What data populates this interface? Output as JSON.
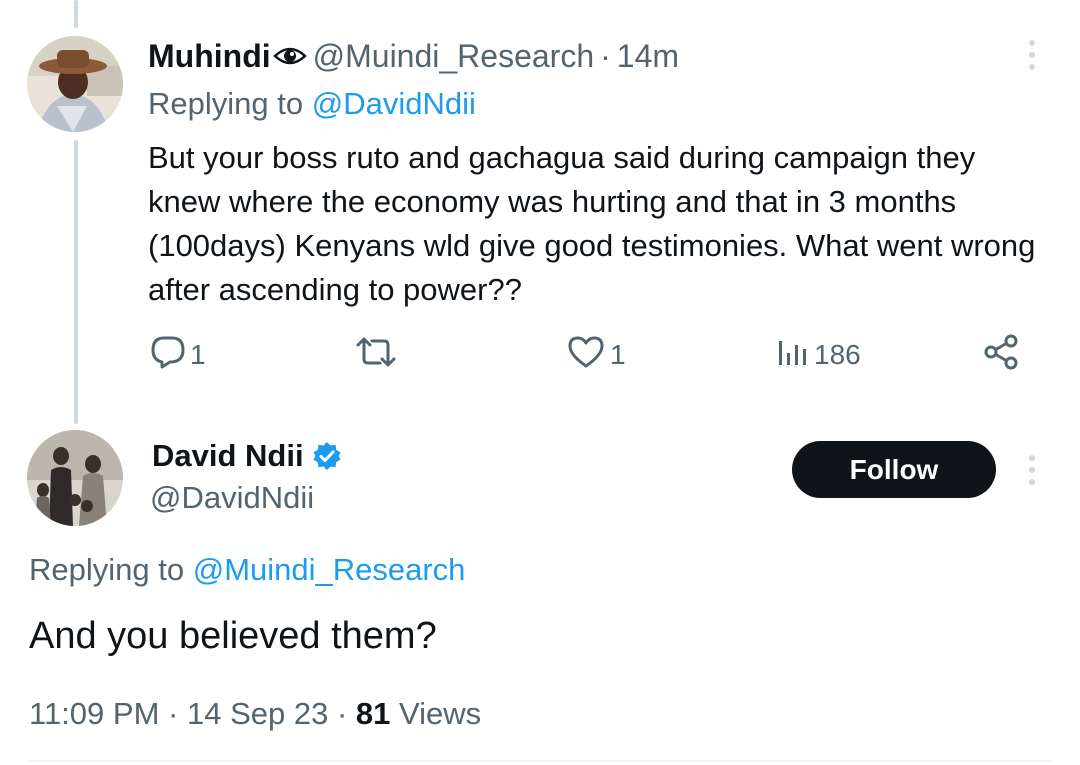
{
  "reply_tweet": {
    "author_name": "Muhindi",
    "author_handle": "@Muindi_Research",
    "separator": "·",
    "time_ago": "14m",
    "replying_prefix": "Replying to",
    "replying_to": "@DavidNdii",
    "text": "But your boss ruto and gachagua said during campaign they knew where the economy was hurting and that in 3 months (100days) Kenyans wld give good testimonies. What went wrong after ascending to power??",
    "actions": {
      "reply_count": "1",
      "retweet_count": "",
      "like_count": "1",
      "view_count": "186"
    },
    "icons": [
      "eye-icon",
      "reply-icon",
      "retweet-icon",
      "like-icon",
      "views-icon",
      "share-icon",
      "more-icon"
    ]
  },
  "main_tweet": {
    "author_name": "David Ndii",
    "author_handle": "@DavidNdii",
    "verified": true,
    "follow_label": "Follow",
    "replying_prefix": "Replying to",
    "replying_to": "@Muindi_Research",
    "text": "And you believed them?",
    "time": "11:09 PM",
    "date": "14 Sep 23",
    "separator": "·",
    "views_count": "81",
    "views_label": "Views"
  },
  "colors": {
    "text": "#0f1419",
    "secondary": "#536471",
    "link": "#1d9bf0",
    "thread_line": "#cfd9de",
    "follow_bg": "#0f1419"
  }
}
